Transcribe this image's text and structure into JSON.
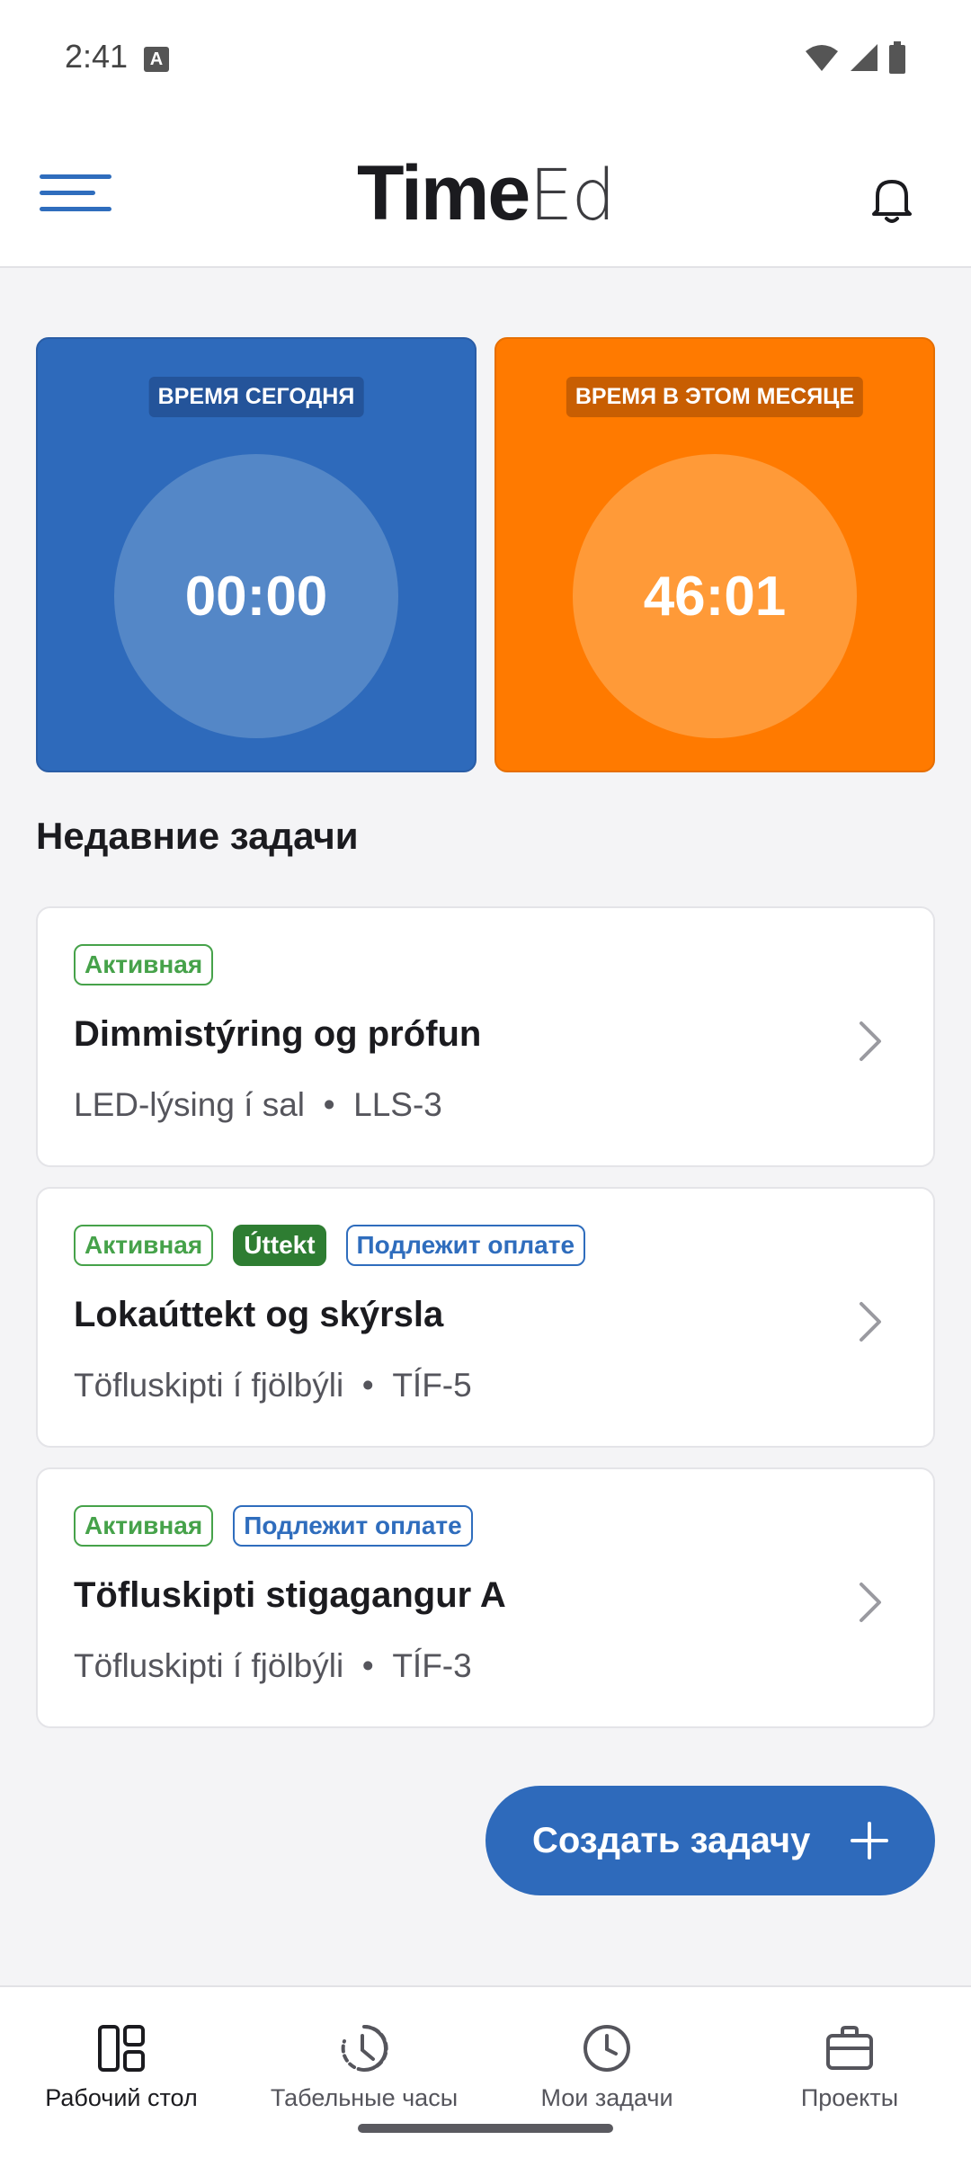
{
  "status_bar": {
    "time": "2:41",
    "notif_letter": "A",
    "icons": [
      "wifi-icon",
      "signal-icon",
      "battery-icon"
    ]
  },
  "header": {
    "logo_part1": "Time",
    "logo_part2": "Ed",
    "icons": [
      "hamburger-menu-icon",
      "bell-icon"
    ]
  },
  "time_cards": [
    {
      "label": "ВРЕМЯ СЕГОДНЯ",
      "value": "00:00",
      "color": "#2E6ABB"
    },
    {
      "label": "ВРЕМЯ В ЭТОМ МЕСЯЦЕ",
      "value": "46:01",
      "color": "#FF7A00"
    }
  ],
  "recent": {
    "title": "Недавние задачи",
    "tasks": [
      {
        "tags": [
          "Активная"
        ],
        "title": "Dimmistýring og prófun",
        "project": "LED-lýsing í sal",
        "separator": "•",
        "code": "LLS-3"
      },
      {
        "tags": [
          "Активная",
          "Úttekt",
          "Подлежит оплате"
        ],
        "title": "Lokaúttekt og skýrsla",
        "project": "Töfluskipti í fjölbýli",
        "separator": "•",
        "code": "TÍF-5"
      },
      {
        "tags": [
          "Активная",
          "Подлежит оплате"
        ],
        "title": "Töfluskipti stigagangur A",
        "project": "Töfluskipti í fjölbýli",
        "separator": "•",
        "code": "TÍF-3"
      }
    ]
  },
  "fab": {
    "label": "Создать задачу",
    "icon": "plus-icon"
  },
  "bottom_nav": [
    {
      "label": "Рабочий стол",
      "icon": "dashboard-icon",
      "active": true
    },
    {
      "label": "Табельные часы",
      "icon": "timer-icon",
      "active": false
    },
    {
      "label": "Мои задачи",
      "icon": "clock-icon",
      "active": false
    },
    {
      "label": "Проекты",
      "icon": "briefcase-icon",
      "active": false
    }
  ],
  "colors": {
    "accent_blue": "#2E6ABB",
    "accent_orange": "#FF7A00",
    "tag_green": "#46A24A",
    "tag_dark_green": "#2E7D32"
  }
}
